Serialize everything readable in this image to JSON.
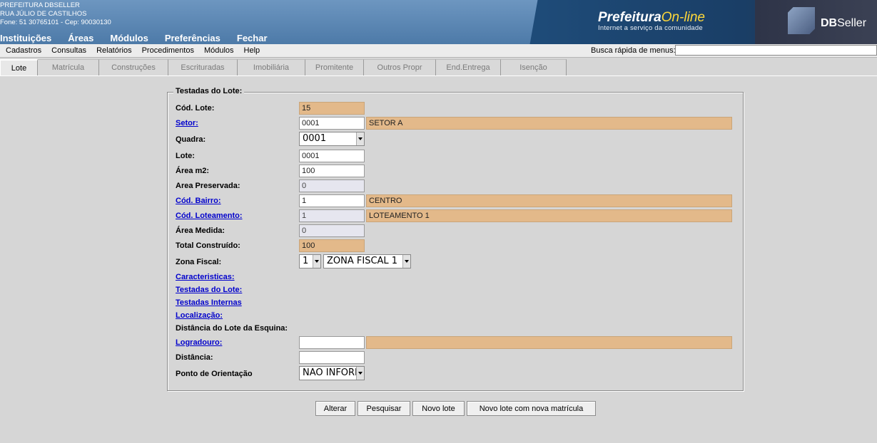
{
  "header": {
    "org_name": "PREFEITURA DBSELLER",
    "address": "RUA JÚLIO DE CASTILHOS",
    "contact": "Fone: 51 30765101  -  Cep: 90030130",
    "menu": [
      "Instituições",
      "Áreas",
      "Módulos",
      "Preferências",
      "Fechar"
    ],
    "brand_title": "Prefeitura",
    "brand_title_accent": "On-line",
    "brand_subtitle": "Internet a serviço da comunidade",
    "vendor_bold": "DB",
    "vendor_rest": "Seller"
  },
  "menubar": {
    "items": [
      "Cadastros",
      "Consultas",
      "Relatórios",
      "Procedimentos",
      "Módulos",
      "Help"
    ],
    "quick_search_label": "Busca rápida de menus:",
    "quick_search_value": ""
  },
  "tabs": [
    {
      "label": "Lote",
      "active": true
    },
    {
      "label": "Matrícula",
      "active": false
    },
    {
      "label": "Construções",
      "active": false
    },
    {
      "label": "Escrituradas",
      "active": false
    },
    {
      "label": "Imobiliária",
      "active": false
    },
    {
      "label": "Promitente",
      "active": false
    },
    {
      "label": "Outros Propr",
      "active": false
    },
    {
      "label": "End.Entrega",
      "active": false
    },
    {
      "label": "Isenção",
      "active": false
    }
  ],
  "form": {
    "legend": "Testadas do Lote:",
    "cod_lote": {
      "label": "Cód. Lote:",
      "value": "15"
    },
    "setor": {
      "label": "Setor:",
      "value": "0001",
      "desc": "SETOR A"
    },
    "quadra": {
      "label": "Quadra:",
      "value": "0001"
    },
    "lote": {
      "label": "Lote:",
      "value": "0001"
    },
    "area_m2": {
      "label": "Área m2:",
      "value": "100"
    },
    "area_preservada": {
      "label": "Area Preservada:",
      "value": "0"
    },
    "cod_bairro": {
      "label": "Cód. Bairro:",
      "value": "1",
      "desc": "CENTRO"
    },
    "cod_loteamento": {
      "label": "Cód. Loteamento:",
      "value": "1",
      "desc": "LOTEAMENTO 1"
    },
    "area_medida": {
      "label": "Área Medida:",
      "value": "0"
    },
    "total_construido": {
      "label": "Total Construído:",
      "value": "100"
    },
    "zona_fiscal": {
      "label": "Zona Fiscal:",
      "code": "1",
      "name": "ZONA FISCAL 1"
    },
    "caracteristicas": "Caracteristicas:",
    "testadas_lote": "Testadas do Lote:",
    "testadas_internas": "Testadas Internas",
    "localizacao": "Localização:",
    "distancia_esquina": "Distância do Lote da Esquina:",
    "logradouro": {
      "label": "Logradouro:",
      "value": "",
      "desc": ""
    },
    "distancia": {
      "label": "Distância:",
      "value": ""
    },
    "ponto_orientacao": {
      "label": "Ponto de Orientação",
      "value": "NAO INFORMADO"
    }
  },
  "buttons": {
    "alterar": "Alterar",
    "pesquisar": "Pesquisar",
    "novo_lote": "Novo lote",
    "novo_lote_matricula": "Novo lote com nova matrícula"
  },
  "colors": {
    "header_blue": "#5b86b3",
    "readonly_field": "#e3b98a",
    "link": "#0000cc",
    "brand_accent": "#ffd83a"
  }
}
